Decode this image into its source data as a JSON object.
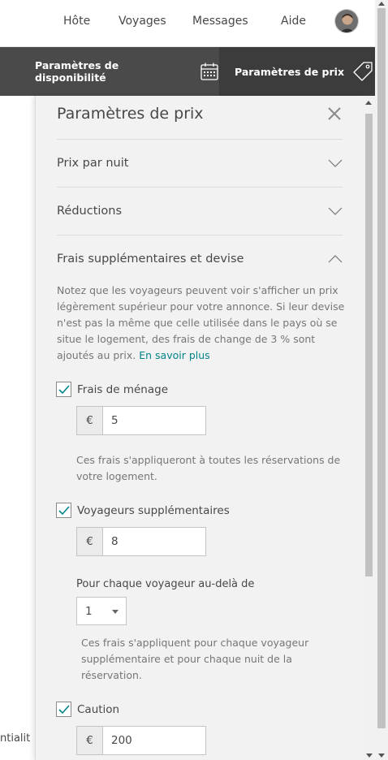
{
  "nav": {
    "links": [
      "Hôte",
      "Voyages",
      "Messages",
      "Aide"
    ]
  },
  "settings_bar": {
    "availability_label": "Paramètres de disponibilité",
    "price_label": "Paramètres de prix"
  },
  "background": {
    "partial_text": "ntialit"
  },
  "panel": {
    "title": "Paramètres de prix",
    "sections": [
      {
        "label": "Prix par nuit",
        "expanded": false
      },
      {
        "label": "Réductions",
        "expanded": false
      },
      {
        "label": "Frais supplémentaires et devise",
        "expanded": true
      }
    ],
    "description": "Notez que les voyageurs peuvent voir s'afficher un prix légèrement supérieur pour votre annonce. Si leur devise n'est pas la même que celle utilisée dans le pays où se situe le logement, des frais de change de 3 % sont ajoutés au prix.",
    "learn_more": "En savoir plus",
    "cleaning_fee": {
      "label": "Frais de ménage",
      "checked": true,
      "currency": "€",
      "value": "5",
      "note": "Ces frais s'appliqueront à toutes les réservations de votre logement."
    },
    "extra_guests": {
      "label": "Voyageurs supplémentaires",
      "checked": true,
      "currency": "€",
      "value": "8",
      "per_guest_label": "Pour chaque voyageur au-delà de",
      "guest_threshold": "1",
      "note": "Ces frais s'appliquent pour chaque voyageur supplémentaire et pour chaque nuit de la réservation."
    },
    "deposit": {
      "label": "Caution",
      "checked": true,
      "currency": "€",
      "value": "200"
    }
  },
  "colors": {
    "link": "#008489",
    "bar_bg": "#4a4a4a",
    "panel_bg": "#f2f2f2"
  }
}
